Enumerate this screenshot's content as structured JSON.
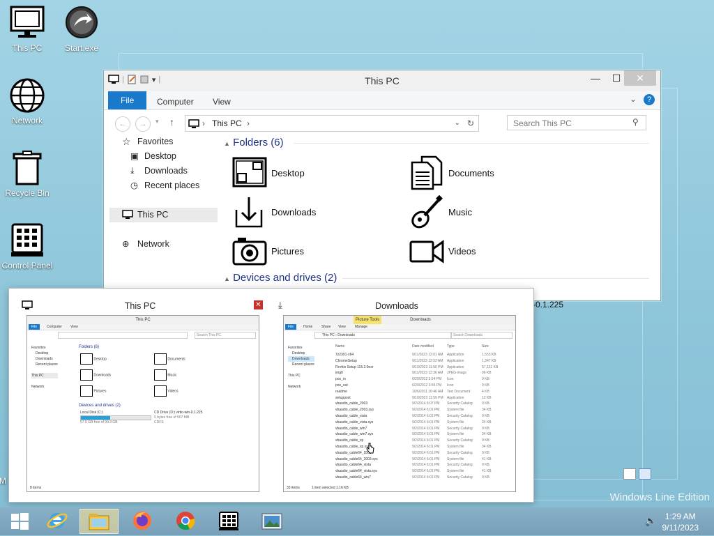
{
  "desktop": {
    "icons": [
      {
        "label": "This PC",
        "icon": "monitor-icon"
      },
      {
        "label": "Start.exe",
        "icon": "start-orb-icon"
      },
      {
        "label": "Network",
        "icon": "globe-icon"
      },
      {
        "label": "Recycle Bin",
        "icon": "recycle-bin-icon"
      },
      {
        "label": "Control Panel",
        "icon": "control-panel-icon"
      }
    ],
    "edition_text": "Windows Line Edition",
    "partial_icon_label": "M"
  },
  "explorer": {
    "title": "This PC",
    "ribbon_tabs": [
      "File",
      "Computer",
      "View"
    ],
    "address_path": "This PC",
    "search_placeholder": "Search This PC",
    "nav": {
      "favorites": "Favorites",
      "favorite_items": [
        "Desktop",
        "Downloads",
        "Recent places"
      ],
      "this_pc": "This PC",
      "network": "Network"
    },
    "folders_header": "Folders (6)",
    "folders": [
      "Desktop",
      "Documents",
      "Downloads",
      "Music",
      "Pictures",
      "Videos"
    ],
    "devices_header": "Devices and drives (2)",
    "drive_partial_text": "-0.1.225"
  },
  "switcher": {
    "thumbs": [
      {
        "title": "This PC",
        "mini_title": "This PC",
        "mini_tabs": [
          "File",
          "Computer",
          "View"
        ],
        "mini_nav": [
          "Favorites",
          "Desktop",
          "Downloads",
          "Recent places",
          "This PC",
          "Network"
        ],
        "mini_folders_header": "Folders (6)",
        "mini_folders": [
          "Desktop",
          "Documents",
          "Downloads",
          "Music",
          "Pictures",
          "Videos"
        ],
        "mini_devices_header": "Devices and drives (2)",
        "drives": [
          {
            "name": "Local Disk (C:)",
            "info": "57.5 GB free of 99.3 GB"
          },
          {
            "name": "CD Drive (D:) virtio-win-0.1.225",
            "info": "0 bytes free of 507 MB",
            "fs": "CDFS"
          }
        ],
        "status": "8 items",
        "search": "Search This PC"
      },
      {
        "title": "Downloads",
        "mini_title": "Downloads",
        "mini_tabs": [
          "File",
          "Home",
          "Share",
          "View",
          "Manage"
        ],
        "picture_tools": "Picture Tools",
        "address": "This PC › Downloads",
        "search": "Search Downloads",
        "mini_nav": [
          "Favorites",
          "Desktop",
          "Downloads",
          "Recent places",
          "This PC",
          "Network"
        ],
        "columns": [
          "Name",
          "Date modified",
          "Type",
          "Size"
        ],
        "files": [
          [
            "7z2301-x64",
            "9/11/2023 12:01 AM",
            "Application",
            "1,553 KB"
          ],
          [
            "ChromeSetup",
            "9/11/2023 12:52 AM",
            "Application",
            "1,347 KB"
          ],
          [
            "Firefox Setup 115.2.0esr",
            "9/10/2023 11:50 PM",
            "Application",
            "57,131 KB"
          ],
          [
            "img0",
            "9/11/2023 12:36 AM",
            "JPEG image",
            "96 KB"
          ],
          [
            "pos_in",
            "6/20/2012 3:54 PM",
            "Icon",
            "9 KB"
          ],
          [
            "pos_out",
            "6/20/2012 3:55 PM",
            "Icon",
            "9 KB"
          ],
          [
            "readme",
            "10/6/2011 10:46 AM",
            "Text Document",
            "4 KB"
          ],
          [
            "setuppost",
            "9/10/2023 11:59 PM",
            "Application",
            "12 KB"
          ],
          [
            "vbaudio_cable_2003",
            "9/2/2014 6:07 PM",
            "Security Catalog",
            "9 KB"
          ],
          [
            "vbaudio_cable_2003.sys",
            "9/2/2014 6:01 PM",
            "System file",
            "34 KB"
          ],
          [
            "vbaudio_cable_vista",
            "9/2/2014 6:01 PM",
            "Security Catalog",
            "9 KB"
          ],
          [
            "vbaudio_cable_vista.sys",
            "9/2/2014 6:01 PM",
            "System file",
            "34 KB"
          ],
          [
            "vbaudio_cable_win7",
            "9/2/2014 6:01 PM",
            "Security Catalog",
            "9 KB"
          ],
          [
            "vbaudio_cable_win7.sys",
            "9/2/2014 6:01 PM",
            "System file",
            "34 KB"
          ],
          [
            "vbaudio_cable_xp",
            "9/2/2014 6:01 PM",
            "Security Catalog",
            "9 KB"
          ],
          [
            "vbaudio_cable_xp.sys",
            "9/2/2014 6:01 PM",
            "System file",
            "34 KB"
          ],
          [
            "vbaudio_cable64_2003",
            "9/2/2014 6:01 PM",
            "Security Catalog",
            "9 KB"
          ],
          [
            "vbaudio_cable64_2003.sys",
            "9/2/2014 6:01 PM",
            "System file",
            "41 KB"
          ],
          [
            "vbaudio_cable64_vista",
            "9/2/2014 6:01 PM",
            "Security Catalog",
            "9 KB"
          ],
          [
            "vbaudio_cable64_vista.sys",
            "9/2/2014 6:01 PM",
            "System file",
            "41 KB"
          ],
          [
            "vbaudio_cable64_win7",
            "9/2/2014 6:01 PM",
            "Security Catalog",
            "9 KB"
          ]
        ],
        "status_left": "33 items",
        "status_right": "1 item selected  1.16 KB"
      }
    ]
  },
  "taskbar": {
    "items": [
      "start-button",
      "internet-explorer-icon",
      "file-explorer-icon",
      "firefox-icon",
      "chrome-icon",
      "control-panel-icon",
      "photo-viewer-icon"
    ],
    "time": "1:29 AM",
    "date": "9/11/2023"
  }
}
